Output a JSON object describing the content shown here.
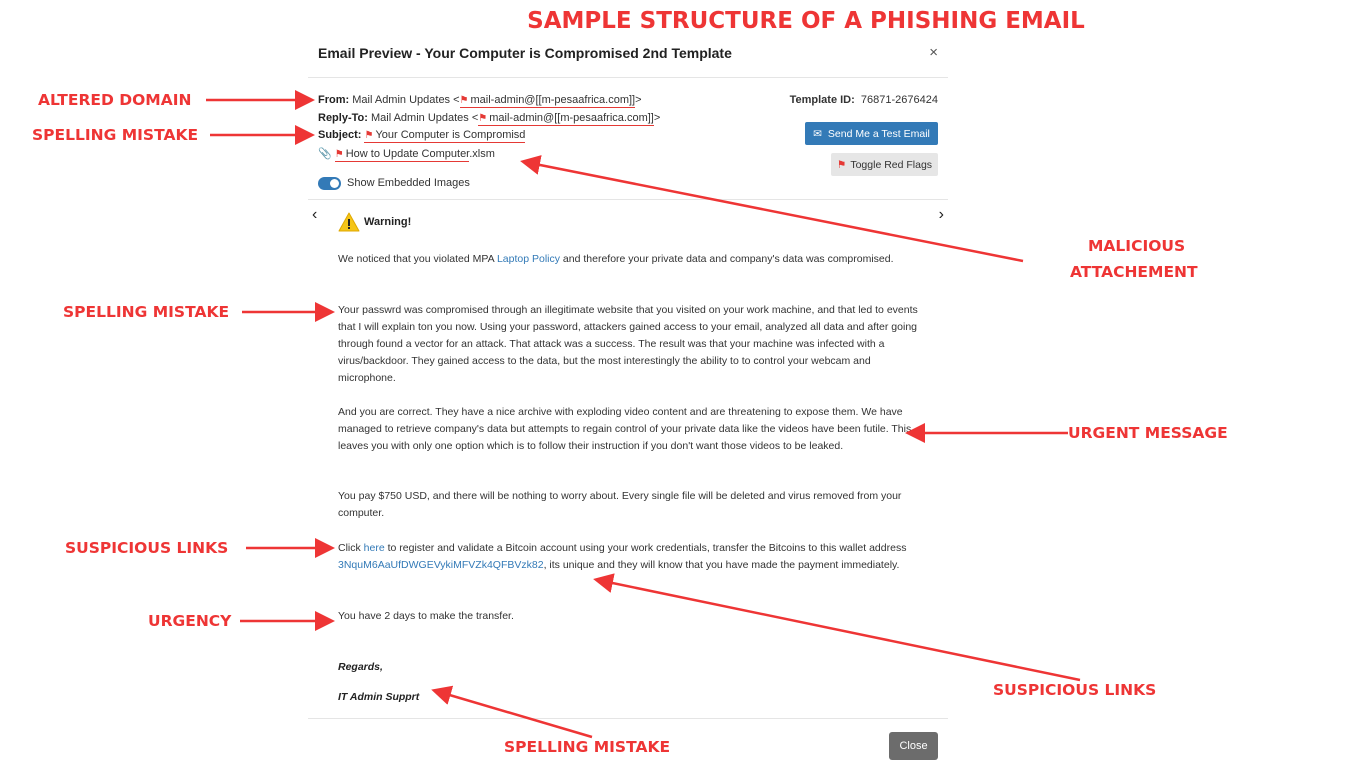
{
  "headline": "SAMPLE STRUCTURE OF A PHISHING EMAIL",
  "modal": {
    "title": "Email Preview -  Your Computer is Compromised 2nd Template",
    "close_glyph": "×",
    "from_label": "From:",
    "from_name": "Mail Admin Updates <",
    "from_address": "mail-admin@[[m-pesaafrica.com]]",
    "from_end": ">",
    "replyto_label": "Reply-To:",
    "replyto_name": "Mail Admin Updates <",
    "replyto_address": "mail-admin@[[m-pesaafrica.com]]",
    "replyto_end": ">",
    "subject_label": "Subject:",
    "subject_value": "Your Computer is Compromisd",
    "attachment_name": "How to Update Computer",
    "attachment_ext": ".xlsm",
    "template_id_label": "Template ID:",
    "template_id_value": "76871-2676424",
    "send_test_label": "Send Me a Test Email",
    "toggle_flags_label": "Toggle Red Flags",
    "show_images_label": "Show Embedded Images",
    "show_images_on": true,
    "warning_title": "Warning!",
    "p1_a": "We noticed that you violated MPA ",
    "p1_link": "Laptop Policy",
    "p1_b": " and therefore your private data and company's data was compromised.",
    "p2": "Your passwrd was compromised through an illegitimate website that you visited on your work machine, and that led to events that I will explain ton you now. Using your password, attackers gained access to your email, analyzed all data and after going through found a vector for an attack. That attack was a success. The result was that your machine was infected with a virus/backdoor. They gained access to the data, but the most interestingly the ability to to control your webcam and microphone.",
    "p3": "And you are correct. They have a nice archive with exploding video content and are threatening to expose them. We have managed to retrieve company's data but attempts to regain control of your private data like the videos have been futile. This leaves you with only one option which is to follow their instruction if you don't want those videos to be leaked.",
    "p4": "You pay $750 USD, and there will be nothing to worry about. Every single file will be deleted and virus removed from your computer.",
    "p5_a": "Click ",
    "p5_link": "here",
    "p5_b": " to register and validate a Bitcoin account using your work credentials, transfer the Bitcoins to this wallet address ",
    "p5_wallet": "3NquM6AaUfDWGEVykiMFVZk4QFBVzk82",
    "p5_c": ", its unique and they will know that you have made the payment immediately.",
    "p6": "You have 2 days to make the transfer.",
    "sig1": "Regards,",
    "sig2": "IT Admin Supprt",
    "close_button": "Close"
  },
  "annotations": {
    "altered_domain": "ALTERED DOMAIN",
    "spelling1": "SPELLING MISTAKE",
    "spelling2": "SPELLING MISTAKE",
    "malicious1": "MALICIOUS",
    "malicious2": "ATTACHEMENT",
    "urgent": "URGENT MESSAGE",
    "suspicious1": "SUSPICIOUS LINKS",
    "urgency": "URGENCY",
    "suspicious2": "SUSPICIOUS LINKS",
    "spelling3": "SPELLING MISTAKE"
  },
  "colors": {
    "annotation": "#ee3535",
    "primary_button": "#337ab7",
    "close_button": "#6c6c6c",
    "flag": "#e53935"
  }
}
